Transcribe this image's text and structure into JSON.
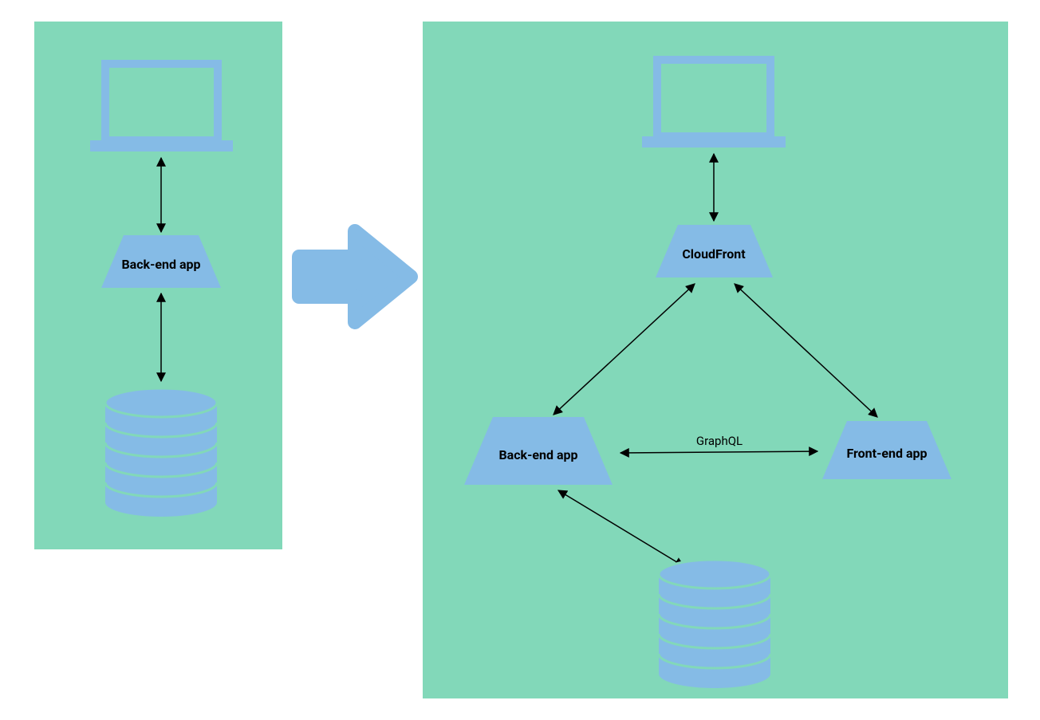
{
  "colors": {
    "panel_bg": "#82d8b9",
    "shape_fill": "#85bbe6",
    "shape_stroke": "#85bbe6",
    "arrow_big": "#85bbe6",
    "line": "#000000"
  },
  "left_diagram": {
    "backend_label": "Back-end app"
  },
  "right_diagram": {
    "cloudfront_label": "CloudFront",
    "backend_label": "Back-end app",
    "frontend_label": "Front-end app",
    "graphql_label": "GraphQL"
  }
}
